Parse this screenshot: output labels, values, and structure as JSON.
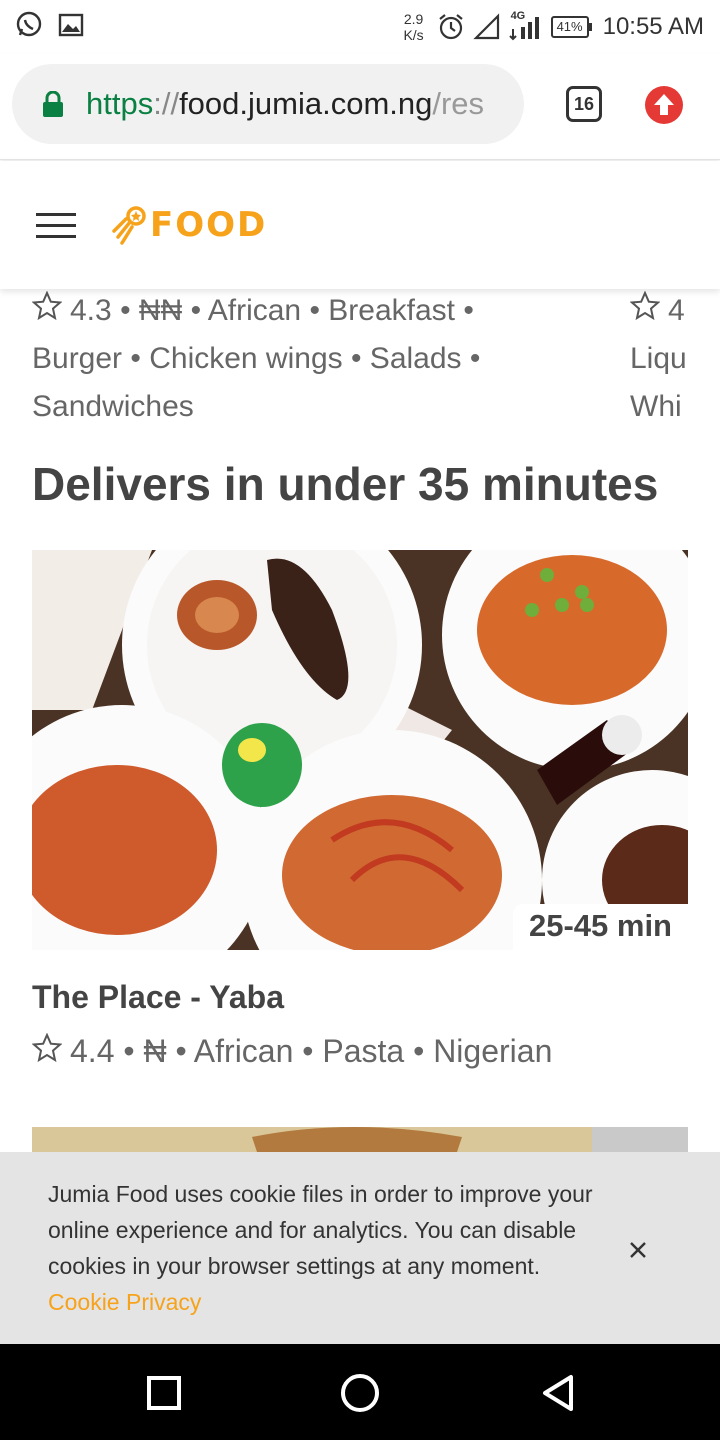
{
  "status_bar": {
    "net_speed_value": "2.9",
    "net_speed_unit": "K/s",
    "network_label": "4G",
    "battery": "41%",
    "time": "10:55 AM"
  },
  "browser": {
    "url_https": "https",
    "url_sep": "://",
    "url_domain": "food.jumia.com.ng",
    "url_rest": "/res",
    "tab_count": "16"
  },
  "header": {
    "logo_text": "FOOD"
  },
  "previous_card": {
    "rating": "4.3",
    "info": "• ₦₦ • African • Breakfast • Burger • Chicken wings • Salads • Sandwiches"
  },
  "previous_card_right": {
    "rating": "4",
    "line2": "Liqu",
    "line3": "Whi"
  },
  "section": {
    "title": "Delivers in under 35 minutes"
  },
  "restaurant": {
    "delivery_time": "25-45 min",
    "name": "The Place - Yaba",
    "rating": "4.4",
    "info": "• ₦ • African • Pasta • Nigerian"
  },
  "cookie_banner": {
    "text": "Jumia Food uses cookie files in order to improve your online experience and for analytics. You can disable cookies in your browser settings at any moment.",
    "link": "Cookie Privacy"
  },
  "colors": {
    "brand_orange": "#f7a21b",
    "https_green": "#0b8043",
    "upload_red": "#e53935"
  },
  "icons": [
    "whatsapp-icon",
    "image-icon",
    "alarm-icon",
    "signal-icon",
    "lock-icon",
    "upload-icon",
    "hamburger-icon",
    "star-icon",
    "close-icon",
    "recents-icon",
    "home-icon",
    "back-icon"
  ]
}
